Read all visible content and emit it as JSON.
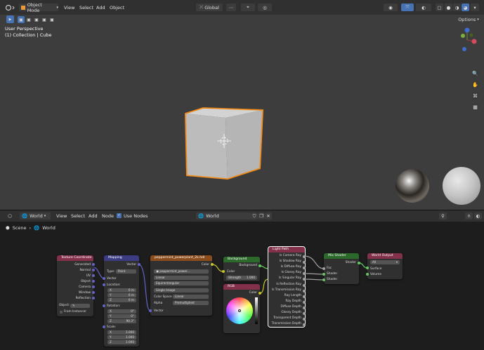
{
  "top_header": {
    "mode": "Object Mode",
    "menus": [
      "View",
      "Select",
      "Add",
      "Object"
    ],
    "transform": "Global"
  },
  "options_label": "Options",
  "viewport": {
    "perspective": "User Perspective",
    "collection": "(1) Collection | Cube"
  },
  "node_header": {
    "world_type": "World",
    "menus": [
      "View",
      "Select",
      "Add",
      "Node"
    ],
    "use_nodes": "Use Nodes",
    "world_name": "World"
  },
  "breadcrumb": {
    "scene": "Scene",
    "world": "World"
  },
  "colors": {
    "accent": "#4772b3",
    "selected_outline": "#f18b1a",
    "viewport_bg": "#3d3d3d",
    "node_bg": "#1d1d1d"
  },
  "nodes": {
    "texcoord": {
      "title": "Texture Coordinate",
      "outputs": [
        "Generated",
        "Normal",
        "UV",
        "Object",
        "Camera",
        "Window",
        "Reflection"
      ],
      "object_label": "Object:",
      "from_instancer": "From Instancer"
    },
    "mapping": {
      "title": "Mapping",
      "out": "Vector",
      "type_label": "Type:",
      "type_value": "Point",
      "vector": "Vector",
      "location": "Location:",
      "loc": [
        [
          "X",
          "0 m"
        ],
        [
          "Y",
          "0 m"
        ],
        [
          "Z",
          "0 m"
        ]
      ],
      "rotation": "Rotation:",
      "rot": [
        [
          "X",
          "0°"
        ],
        [
          "Y",
          "0°"
        ],
        [
          "Z",
          "90.3°"
        ]
      ],
      "scale": "Scale:",
      "scl": [
        [
          "X",
          "1.000"
        ],
        [
          "Y",
          "1.000"
        ],
        [
          "Z",
          "1.000"
        ]
      ]
    },
    "envtex": {
      "title": "peppermint_powerplant_2k.hdr",
      "out": "Color",
      "image": "peppermint_power...",
      "interp": "Linear",
      "proj": "Equirectangular",
      "src": "Single Image",
      "cs_label": "Color Space",
      "cs_value": "Linear",
      "alpha_label": "Alpha",
      "alpha_value": "Premultiplied",
      "vector": "Vector"
    },
    "background": {
      "title": "Background",
      "out": "Background",
      "color": "Color",
      "strength_label": "Strength",
      "strength": "1.000"
    },
    "rgb": {
      "title": "RGB",
      "out": "Color"
    },
    "lightpath": {
      "title": "Light Path",
      "outputs": [
        "Is Camera Ray",
        "Is Shadow Ray",
        "Is Diffuse Ray",
        "Is Glossy Ray",
        "Is Singular Ray",
        "Is Reflection Ray",
        "Is Transmission Ray",
        "Ray Length",
        "Ray Depth",
        "Diffuse Depth",
        "Glossy Depth",
        "Transparent Depth",
        "Transmission Depth"
      ]
    },
    "mixshader": {
      "title": "Mix Shader",
      "out": "Shader",
      "inputs": [
        "Fac",
        "Shader",
        "Shader"
      ]
    },
    "worldout": {
      "title": "World Output",
      "target": "All",
      "inputs": [
        "Surface",
        "Volume"
      ]
    }
  }
}
